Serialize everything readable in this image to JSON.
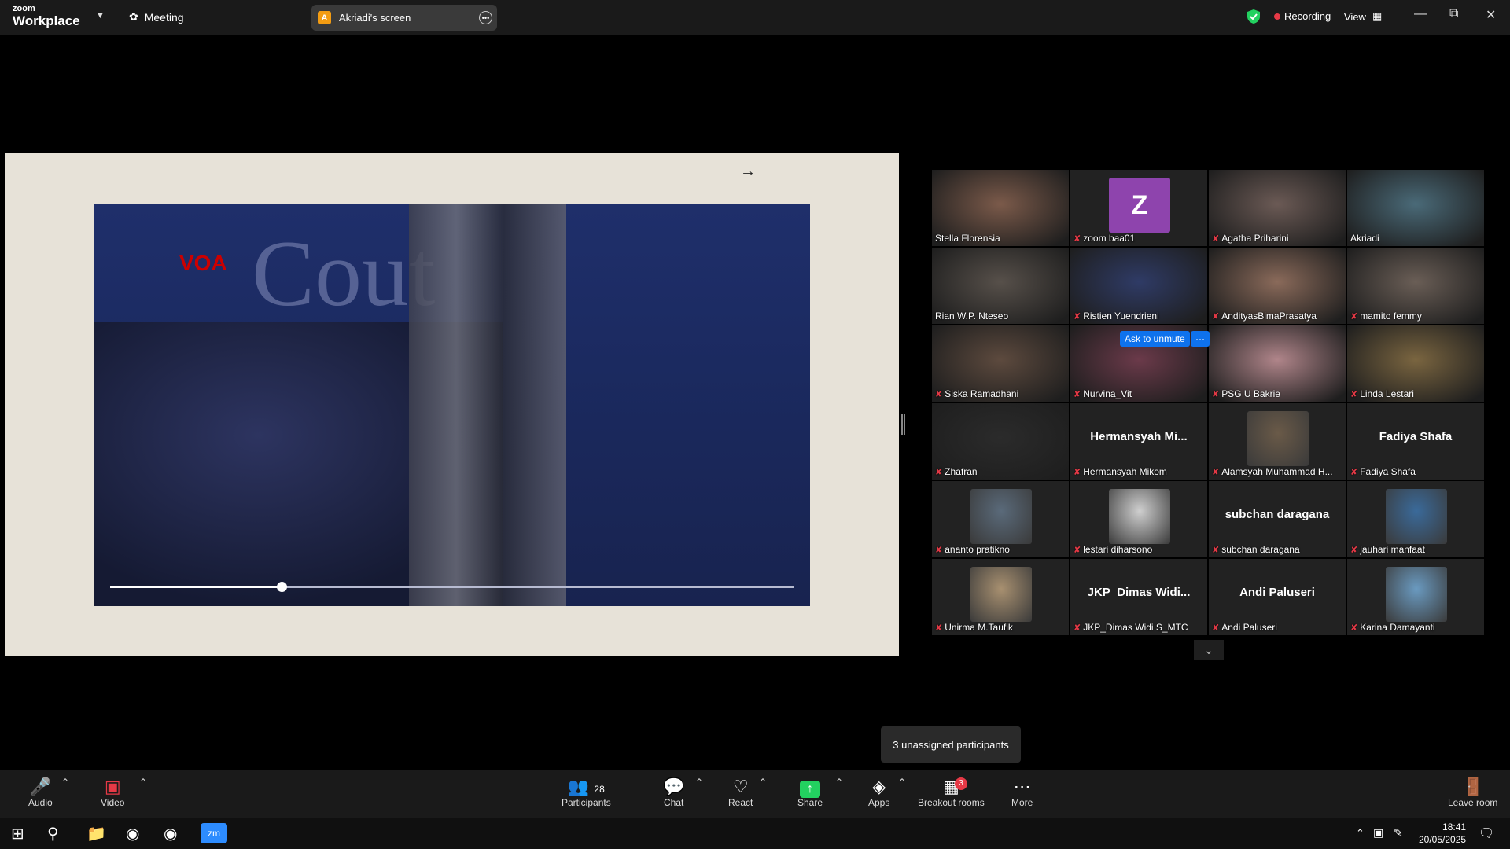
{
  "app": {
    "brand_top": "zoom",
    "brand_bottom": "Workplace",
    "meeting_label": "Meeting"
  },
  "screen_share": {
    "avatar_letter": "A",
    "label": "Akriadi's screen"
  },
  "status": {
    "recording": "Recording",
    "view": "View"
  },
  "shared_content": {
    "overlay_text": "Cout",
    "channel_logo": "VOA",
    "video_progress": 0.25
  },
  "tiles": [
    {
      "name": "Stella Florensia",
      "kind": "photo",
      "muted": false,
      "color": "#7b5a4a"
    },
    {
      "name": "zoom baa01",
      "kind": "letter",
      "letter": "Z",
      "muted": true,
      "color": "#8e44ad"
    },
    {
      "name": "Agatha Priharini",
      "kind": "photo",
      "muted": true,
      "color": "#6b5a55"
    },
    {
      "name": "Akriadi",
      "kind": "photo",
      "muted": false,
      "active": true,
      "color": "#4a6a78"
    },
    {
      "name": "Rian W.P. Nteseo",
      "kind": "photo",
      "muted": false,
      "color": "#57504a"
    },
    {
      "name": "Ristien Yuendrieni",
      "kind": "photo",
      "muted": true,
      "color": "#2f3b66"
    },
    {
      "name": "AndityasBimaPrasatya",
      "kind": "photo",
      "muted": true,
      "color": "#8a6a5a"
    },
    {
      "name": "mamito femmy",
      "kind": "photo",
      "muted": true,
      "color": "#6a5e56"
    },
    {
      "name": "Siska Ramadhani",
      "kind": "photo",
      "muted": true,
      "color": "#5d4a3e"
    },
    {
      "name": "Nurvina_Vit",
      "kind": "photo",
      "muted": true,
      "color": "#6b3a4a"
    },
    {
      "name": "PSG U Bakrie",
      "kind": "photo",
      "muted": true,
      "color": "#b0858a"
    },
    {
      "name": "Linda Lestari",
      "kind": "photo",
      "muted": true,
      "color": "#7a6540"
    },
    {
      "name": "Zhafran",
      "kind": "photo",
      "muted": true,
      "color": "#2b2b2b"
    },
    {
      "name": "Hermansyah Mikom",
      "kind": "text",
      "display": "Hermansyah  Mi...",
      "muted": true
    },
    {
      "name": "Alamsyah Muhammad H...",
      "kind": "avatar",
      "muted": true,
      "color": "#6a5a48"
    },
    {
      "name": "Fadiya Shafa",
      "kind": "text",
      "display": "Fadiya Shafa",
      "muted": true
    },
    {
      "name": "ananto pratikno",
      "kind": "avatar",
      "muted": true,
      "color": "#5a6a7a"
    },
    {
      "name": "lestari diharsono",
      "kind": "avatar",
      "muted": true,
      "color": "#cfcfcf"
    },
    {
      "name": "subchan daragana",
      "kind": "text",
      "display": "subchan daragana",
      "muted": true
    },
    {
      "name": "jauhari manfaat",
      "kind": "avatar",
      "muted": true,
      "color": "#3a6a9a"
    },
    {
      "name": "Unirma M.Taufik",
      "kind": "avatar",
      "muted": true,
      "color": "#a89070"
    },
    {
      "name": "JKP_Dimas Widi S_MTC",
      "kind": "text",
      "display": "JKP_Dimas  Widi...",
      "muted": true
    },
    {
      "name": "Andi Paluseri",
      "kind": "text",
      "display": "Andi Paluseri",
      "muted": true
    },
    {
      "name": "Karina Damayanti",
      "kind": "avatar",
      "muted": true,
      "color": "#6a9ac0"
    }
  ],
  "hover_controls": {
    "ask_to_unmute": "Ask to unmute",
    "more": "···"
  },
  "tooltip": "3 unassigned participants",
  "toolbar": {
    "audio": "Audio",
    "video": "Video",
    "participants": "Participants",
    "participants_count": "28",
    "chat": "Chat",
    "react": "React",
    "share": "Share",
    "apps": "Apps",
    "breakout": "Breakout rooms",
    "breakout_badge": "3",
    "more": "More",
    "leave": "Leave room"
  },
  "taskbar": {
    "time": "18:41",
    "date": "20/05/2025"
  }
}
